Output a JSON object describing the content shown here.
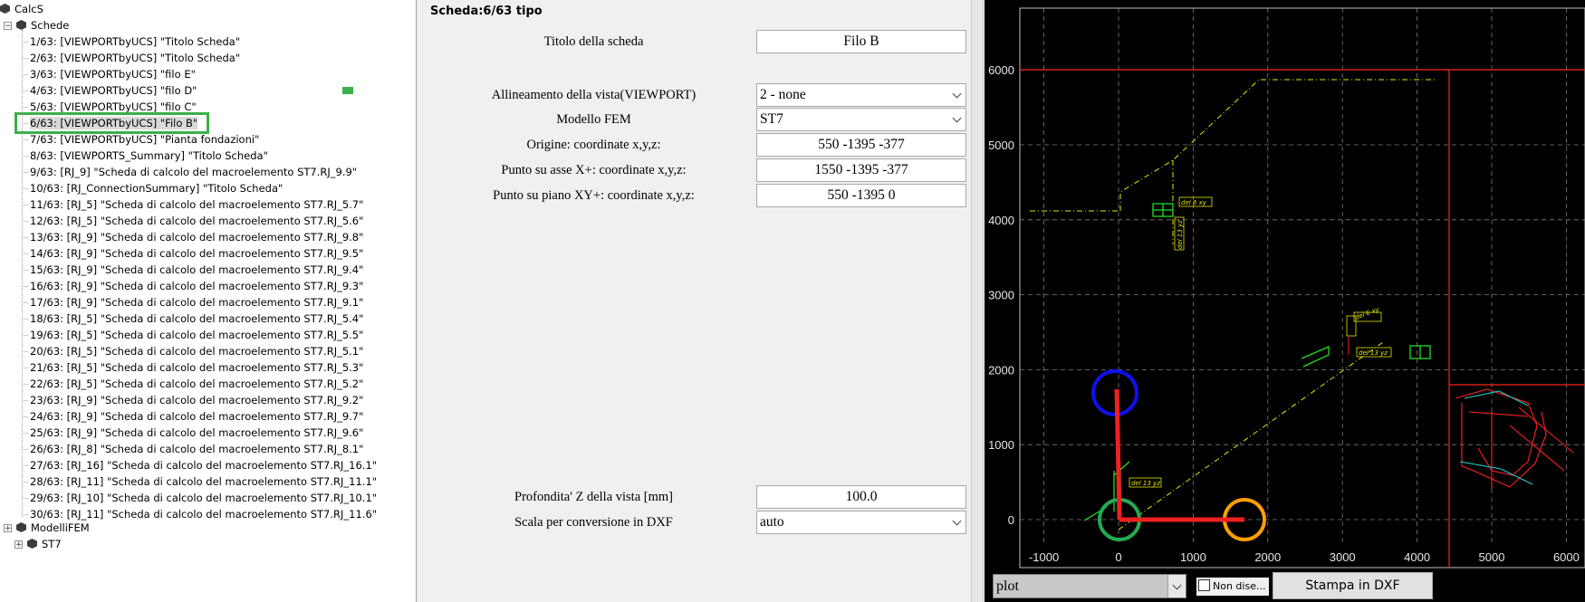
{
  "tree": {
    "root": "CalcS",
    "schede_label": "Schede",
    "items": [
      "1/63: [VIEWPORTbyUCS] \"Titolo Scheda\"",
      "2/63: [VIEWPORTbyUCS] \"Titolo Scheda\"",
      "3/63: [VIEWPORTbyUCS] \"filo E\"",
      "4/63: [VIEWPORTbyUCS] \"filo D\"",
      "5/63: [VIEWPORTbyUCS] \"filo C\"",
      "6/63: [VIEWPORTbyUCS] \"Filo B\"",
      "7/63: [VIEWPORTbyUCS] \"Pianta fondazioni\"",
      "8/63: [VIEWPORTS_Summary] \"Titolo Scheda\"",
      "9/63: [RJ_9] \"Scheda di calcolo del macroelemento ST7.RJ_9.9\"",
      "10/63: [RJ_ConnectionSummary] \"Titolo Scheda\"",
      "11/63: [RJ_5] \"Scheda di calcolo del macroelemento ST7.RJ_5.7\"",
      "12/63: [RJ_5] \"Scheda di calcolo del macroelemento ST7.RJ_5.6\"",
      "13/63: [RJ_9] \"Scheda di calcolo del macroelemento ST7.RJ_9.8\"",
      "14/63: [RJ_9] \"Scheda di calcolo del macroelemento ST7.RJ_9.5\"",
      "15/63: [RJ_9] \"Scheda di calcolo del macroelemento ST7.RJ_9.4\"",
      "16/63: [RJ_9] \"Scheda di calcolo del macroelemento ST7.RJ_9.3\"",
      "17/63: [RJ_9] \"Scheda di calcolo del macroelemento ST7.RJ_9.1\"",
      "18/63: [RJ_5] \"Scheda di calcolo del macroelemento ST7.RJ_5.4\"",
      "19/63: [RJ_5] \"Scheda di calcolo del macroelemento ST7.RJ_5.5\"",
      "20/63: [RJ_5] \"Scheda di calcolo del macroelemento ST7.RJ_5.1\"",
      "21/63: [RJ_5] \"Scheda di calcolo del macroelemento ST7.RJ_5.3\"",
      "22/63: [RJ_5] \"Scheda di calcolo del macroelemento ST7.RJ_5.2\"",
      "23/63: [RJ_9] \"Scheda di calcolo del macroelemento ST7.RJ_9.2\"",
      "24/63: [RJ_9] \"Scheda di calcolo del macroelemento ST7.RJ_9.7\"",
      "25/63: [RJ_9] \"Scheda di calcolo del macroelemento ST7.RJ_9.6\"",
      "26/63: [RJ_8] \"Scheda di calcolo del macroelemento ST7.RJ_8.1\"",
      "27/63: [RJ_16] \"Scheda di calcolo del macroelemento ST7.RJ_16.1\"",
      "28/63: [RJ_11] \"Scheda di calcolo del macroelemento ST7.RJ_11.1\"",
      "29/63: [RJ_10] \"Scheda di calcolo del macroelemento ST7.RJ_10.1\"",
      "30/63: [RJ_11] \"Scheda di calcolo del macroelemento ST7.RJ_11.6\""
    ],
    "selected_index": 5,
    "modelli_label": "ModelliFEM",
    "st7_label": "ST7"
  },
  "form": {
    "title": "Scheda:6/63 tipo",
    "titolo_label": "Titolo della scheda",
    "titolo_value": "Filo B",
    "allineamento_label": "Allineamento della vista(VIEWPORT)",
    "allineamento_value": "2 - none",
    "modello_label": "Modello FEM",
    "modello_value": "ST7",
    "origine_label": "Origine: coordinate x,y,z:",
    "origine_value": "550 -1395 -377",
    "asse_x_label": "Punto su asse X+: coordinate x,y,z:",
    "asse_x_value": "1550 -1395 -377",
    "piano_xy_label": "Punto su piano XY+: coordinate x,y,z:",
    "piano_xy_value": "550 -1395 0",
    "profondita_label": "Profondita' Z della vista [mm]",
    "profondita_value": "100.0",
    "scala_label": "Scala per conversione in DXF",
    "scala_value": "auto"
  },
  "viewer": {
    "x_ticks": [
      "-1000",
      "0",
      "1000",
      "2000",
      "3000",
      "4000",
      "5000",
      "6000"
    ],
    "y_ticks": [
      "0",
      "1000",
      "2000",
      "3000",
      "4000",
      "5000",
      "6000"
    ],
    "annotations": [
      "del 6 xy",
      "del 13 yz",
      "del 6 xy",
      "del 13 yz",
      "del 13 yz"
    ],
    "plot_select_value": "plot",
    "non_disegnare_label": "Non dise...",
    "stampa_button_label": "Stampa in DXF",
    "colors": {
      "grid": "#7a7a7a",
      "frame": "#ff2020",
      "dash": "#e6e600",
      "member": "#22dd22"
    }
  }
}
